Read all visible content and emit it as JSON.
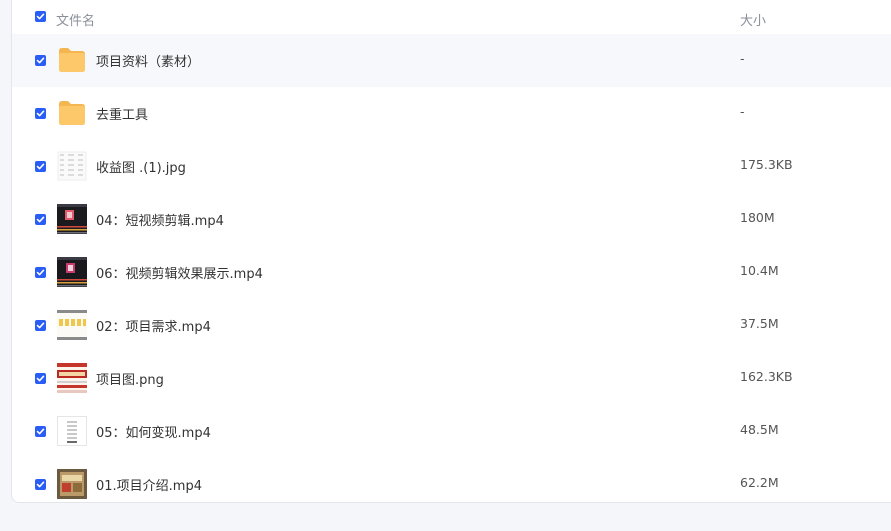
{
  "header": {
    "name_label": "文件名",
    "size_label": "大小"
  },
  "files": [
    {
      "name": "项目资料（素材）",
      "size": "-",
      "icon": "folder-icon"
    },
    {
      "name": "去重工具",
      "size": "-",
      "icon": "folder-icon"
    },
    {
      "name": "收益图 .(1).jpg",
      "size": "175.3KB",
      "icon": "image-thumbnail"
    },
    {
      "name": "04：短视频剪辑.mp4",
      "size": "180M",
      "icon": "video-thumbnail"
    },
    {
      "name": "06：视频剪辑效果展示.mp4",
      "size": "10.4M",
      "icon": "video-thumbnail"
    },
    {
      "name": "02：项目需求.mp4",
      "size": "37.5M",
      "icon": "video-thumbnail"
    },
    {
      "name": "项目图.png",
      "size": "162.3KB",
      "icon": "image-thumbnail"
    },
    {
      "name": "05：如何变现.mp4",
      "size": "48.5M",
      "icon": "video-thumbnail"
    },
    {
      "name": "01.项目介绍.mp4",
      "size": "62.2M",
      "icon": "video-thumbnail"
    }
  ],
  "colors": {
    "checkbox": "#2a5df5",
    "folder": "#fcc86a",
    "row_alt": "#f7f8fc"
  }
}
